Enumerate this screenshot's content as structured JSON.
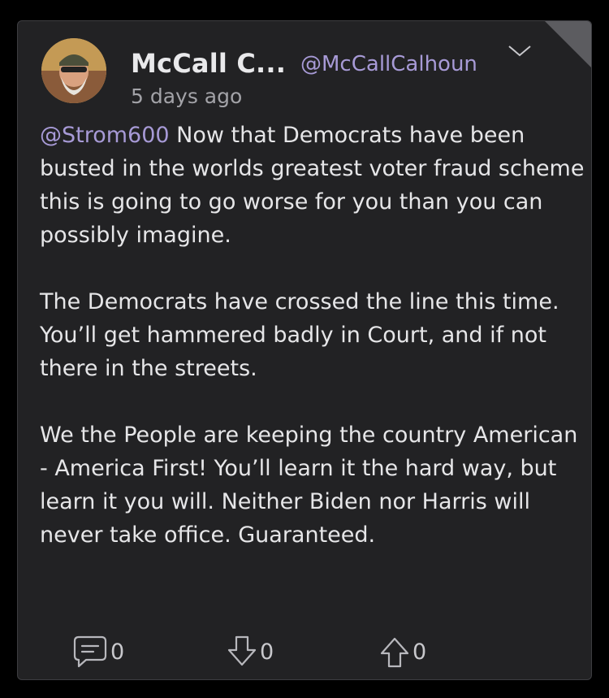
{
  "post": {
    "author_name": "McCall C...",
    "author_handle": "@McCallCalhoun",
    "timestamp": "5 days ago",
    "mention": "@Strom600",
    "paragraph_1_rest": " Now that Democrats have been busted in the worlds greatest voter fraud scheme this is going to go worse for you than you can possibly imagine.",
    "paragraph_2": "The Democrats have crossed the line this time. You’ll get hammered badly in Court, and if not there in the streets.",
    "paragraph_3": "We the People are keeping the country American - America First! You’ll learn it the hard way, but learn it you will. Neither Biden nor Harris will never take office. Guaranteed."
  },
  "actions": {
    "comments": "0",
    "downvotes": "0",
    "upvotes": "0"
  },
  "icons": {
    "menu": "chevron-down-icon",
    "comment": "comment-icon",
    "downvote": "arrow-down-icon",
    "upvote": "arrow-up-icon"
  },
  "colors": {
    "background": "#000000",
    "card": "#222224",
    "accent": "#a79ad6",
    "text": "#e6e6e8",
    "muted": "#a3a3a8"
  }
}
